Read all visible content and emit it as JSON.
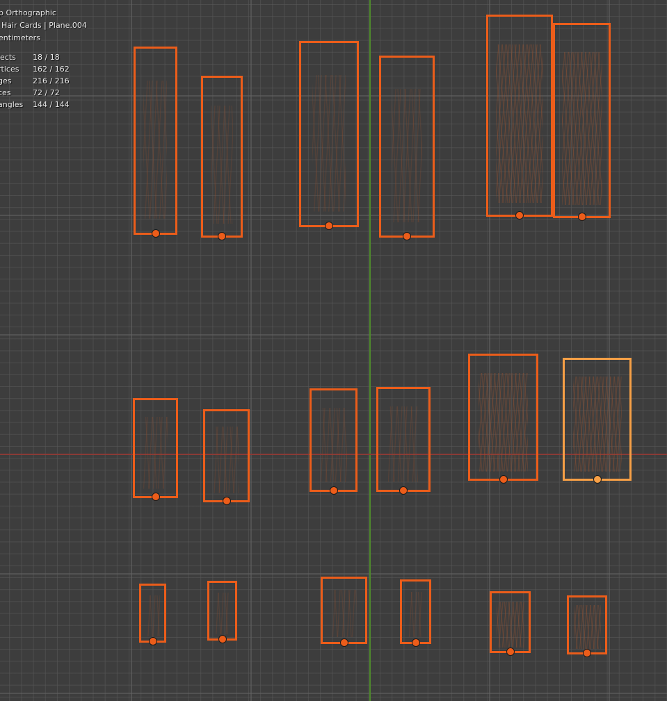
{
  "viewport": {
    "view_name": "p Orthographic",
    "collection_object": "Hair Cards | Plane.004",
    "units": "entimeters",
    "collection_prefix_glyph": "|",
    "stats": [
      {
        "label": "jects",
        "value": "18 / 18"
      },
      {
        "label": "rtices",
        "value": "162 / 162"
      },
      {
        "label": "ges",
        "value": "216 / 216"
      },
      {
        "label": "ces",
        "value": "72 / 72"
      },
      {
        "label": "angles",
        "value": "144 / 144"
      }
    ]
  },
  "colors": {
    "background": "#3d3d3d",
    "grid": "#5a5a5a",
    "x_axis": "#8a3a36",
    "y_axis": "#4f8a2c",
    "selected_outline": "#ec5d1a",
    "active_outline": "#f7a046"
  },
  "cards": [
    {
      "row": 1,
      "state": "selected"
    },
    {
      "row": 1,
      "state": "selected"
    },
    {
      "row": 1,
      "state": "selected"
    },
    {
      "row": 1,
      "state": "selected"
    },
    {
      "row": 1,
      "state": "selected"
    },
    {
      "row": 1,
      "state": "selected"
    },
    {
      "row": 2,
      "state": "selected"
    },
    {
      "row": 2,
      "state": "selected"
    },
    {
      "row": 2,
      "state": "selected"
    },
    {
      "row": 2,
      "state": "selected"
    },
    {
      "row": 2,
      "state": "selected"
    },
    {
      "row": 2,
      "state": "active"
    },
    {
      "row": 3,
      "state": "selected"
    },
    {
      "row": 3,
      "state": "selected"
    },
    {
      "row": 3,
      "state": "selected"
    },
    {
      "row": 3,
      "state": "selected"
    },
    {
      "row": 3,
      "state": "selected"
    },
    {
      "row": 3,
      "state": "selected"
    }
  ]
}
